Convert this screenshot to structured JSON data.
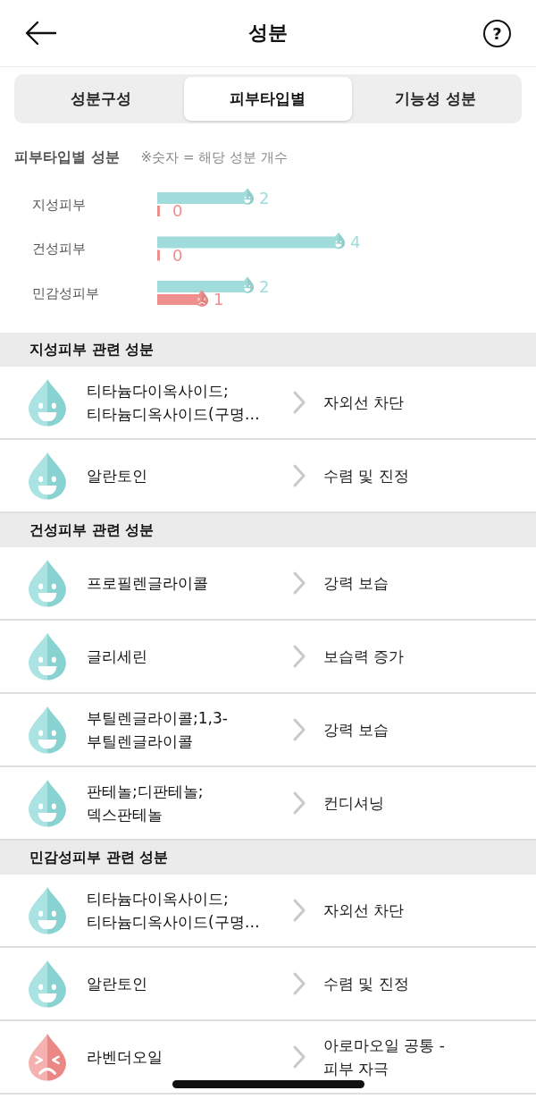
{
  "header": {
    "title": "성분",
    "help": "?"
  },
  "tabs": [
    {
      "label": "성분구성",
      "selected": false
    },
    {
      "label": "피부타입별",
      "selected": true
    },
    {
      "label": "기능성 성분",
      "selected": false
    }
  ],
  "summary": {
    "title": "피부타입별 성분",
    "note": "※숫자 = 해당 성분 개수",
    "chart_data": {
      "type": "bar",
      "orientation": "horizontal",
      "categories": [
        "지성피부",
        "건성피부",
        "민감성피부"
      ],
      "series": [
        {
          "color": "#9fdcdb",
          "values": [
            2,
            4,
            2
          ]
        },
        {
          "color": "#ee8f8d",
          "values": [
            0,
            0,
            1
          ]
        }
      ],
      "data_labels": true
    }
  },
  "sections": [
    {
      "title": "지성피부 관련 성분",
      "ingredients": [
        {
          "kind": "good",
          "name": "티타늄다이옥사이드;\n티타늄디옥사이드(구명…",
          "effect": "자외선 차단"
        },
        {
          "kind": "good",
          "name": "알란토인",
          "effect": "수렴 및 진정"
        }
      ]
    },
    {
      "title": "건성피부 관련 성분",
      "ingredients": [
        {
          "kind": "good",
          "name": "프로필렌글라이콜",
          "effect": "강력 보습"
        },
        {
          "kind": "good",
          "name": "글리세린",
          "effect": "보습력 증가"
        },
        {
          "kind": "good",
          "name": "부틸렌글라이콜;1,3-\n부틸렌글라이콜",
          "effect": "강력 보습"
        },
        {
          "kind": "good",
          "name": "판테놀;디판테놀;\n덱스판테놀",
          "effect": "컨디셔닝"
        }
      ]
    },
    {
      "title": "민감성피부 관련 성분",
      "ingredients": [
        {
          "kind": "good",
          "name": "티타늄다이옥사이드;\n티타늄디옥사이드(구명…",
          "effect": "자외선 차단"
        },
        {
          "kind": "good",
          "name": "알란토인",
          "effect": "수렴 및 진정"
        },
        {
          "kind": "bad",
          "name": "라벤더오일",
          "effect": "아로마오일 공통 -\n피부 자극"
        }
      ]
    }
  ]
}
